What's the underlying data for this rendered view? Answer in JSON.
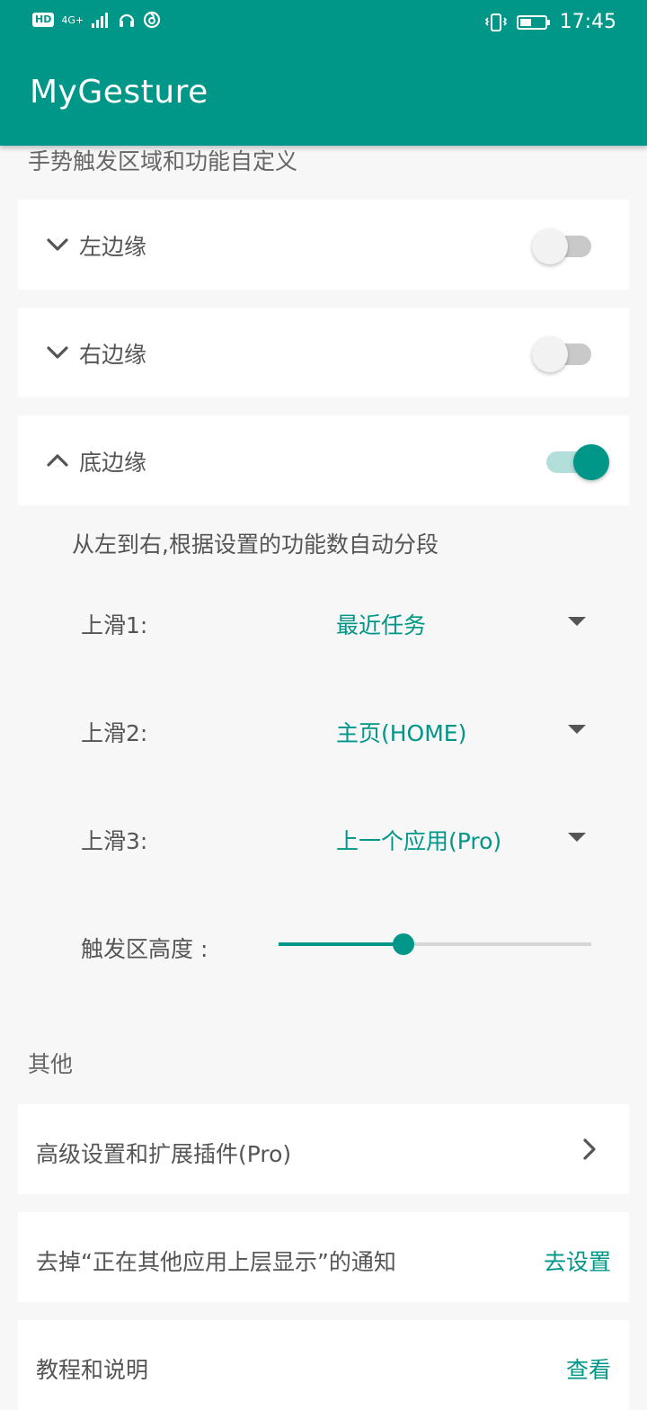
{
  "status_bar": {
    "hd": "HD",
    "network": "4G+",
    "time": "17:45"
  },
  "app": {
    "title": "MyGesture"
  },
  "sections": {
    "gesture_section": "手势触发区域和功能自定义",
    "other_section": "其他"
  },
  "edges": [
    {
      "label": "左边缘",
      "expanded": false,
      "enabled": false
    },
    {
      "label": "右边缘",
      "expanded": false,
      "enabled": false
    },
    {
      "label": "底边缘",
      "expanded": true,
      "enabled": true
    }
  ],
  "bottom_edge": {
    "description": "从左到右,根据设置的功能数自动分段",
    "swipes": [
      {
        "label": "上滑1:",
        "value": "最近任务"
      },
      {
        "label": "上滑2:",
        "value": "主页(HOME)"
      },
      {
        "label": "上滑3:",
        "value": "上一个应用(Pro)"
      }
    ],
    "height_label": "触发区高度 :",
    "height_level": 0.4
  },
  "other_items": [
    {
      "label": "高级设置和扩展插件(Pro)",
      "action": ""
    },
    {
      "label": "去掉“正在其他应用上层显示”的通知",
      "action": "去设置"
    },
    {
      "label": "教程和说明",
      "action": "查看"
    }
  ],
  "colors": {
    "primary": "#009688",
    "switch_on_track": "#b3dfdb",
    "switch_off_track": "#c9c9c9",
    "background": "#f7f7f7"
  },
  "icons": {
    "expand": "chevron-down-icon",
    "collapse": "chevron-up-icon",
    "navigate": "chevron-right-icon",
    "dropdown": "dropdown-arrow-icon"
  }
}
